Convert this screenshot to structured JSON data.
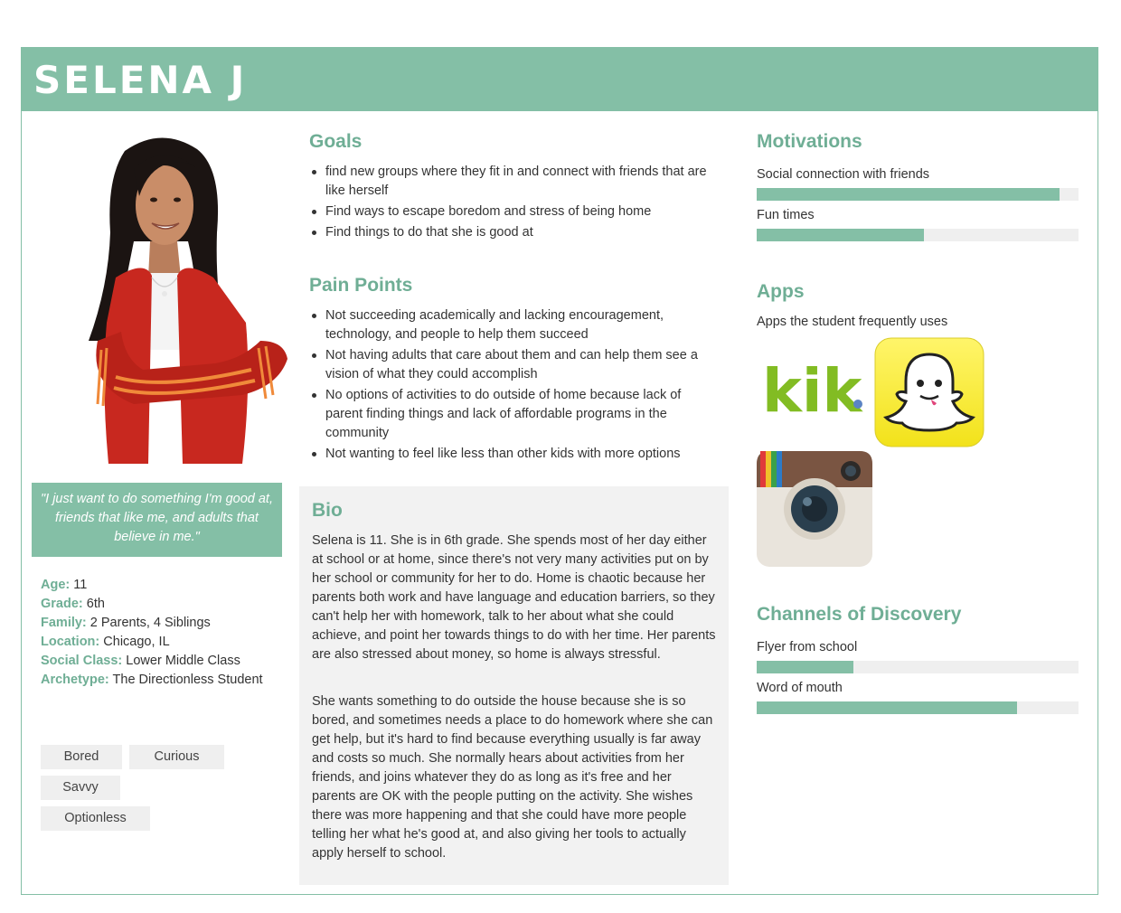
{
  "persona": {
    "name": "SELENA J",
    "quote": "\"I just want to do something I'm good at, friends that like me, and adults that believe in me.\"",
    "facts": [
      {
        "key": "Age:",
        "value": " 11"
      },
      {
        "key": "Grade:",
        "value": " 6th"
      },
      {
        "key": "Family:",
        "value": " 2 Parents, 4 Siblings"
      },
      {
        "key": "Location:",
        "value": " Chicago, IL"
      },
      {
        "key": "Social Class:",
        "value": " Lower Middle Class"
      },
      {
        "key": "Archetype:",
        "value": " The Directionless Student"
      }
    ],
    "tags": [
      "Bored",
      "Curious",
      "Savvy",
      "Optionless"
    ]
  },
  "goals": {
    "title": "Goals",
    "items": [
      "find new groups where they fit in and connect with friends that are like herself",
      "Find ways to escape boredom and stress of being home",
      "Find things to do that she is good at"
    ]
  },
  "pain_points": {
    "title": "Pain Points",
    "items": [
      "Not succeeding academically and lacking encouragement, technology, and people to help them succeed",
      "Not having adults that care about them and can help them see a vision of what they could accomplish",
      "No options of activities to do outside of home because lack of parent finding things and lack of affordable programs in the community",
      "Not wanting to feel like less than other kids with more options"
    ]
  },
  "bio": {
    "title": "Bio",
    "paragraphs": [
      "Selena is 11. She is in 6th grade. She spends most of her day either at school or at home, since there's not very many activities put on by her school or community for her to do. Home is chaotic because her parents both work and have language and education barriers, so they can't help her with homework, talk to her about what she could achieve, and point her towards things to do with her time. Her parents are also stressed about money, so home is always stressful.",
      "She wants something to do outside the house because she is so bored, and sometimes needs a place to do homework where she can get help, but it's hard to find because everything usually is far away and costs so much. She normally hears about activities from her friends, and joins whatever they do as long as it's free and her parents are OK with the people putting on the activity. She wishes there was more happening and that she could have more people telling her what he's good at, and also giving her tools to actually apply herself to school."
    ]
  },
  "motivations": {
    "title": "Motivations",
    "items": [
      {
        "label": "Social connection with friends",
        "level": 0.94
      },
      {
        "label": "Fun times",
        "level": 0.52
      }
    ]
  },
  "apps": {
    "title": "Apps",
    "subtitle": "Apps the student frequently uses",
    "icons": [
      {
        "name": "kik-icon",
        "wordmark": "kik"
      },
      {
        "name": "snapchat-icon"
      },
      {
        "name": "instagram-icon"
      }
    ]
  },
  "channels": {
    "title": "Channels of Discovery",
    "items": [
      {
        "label": "Flyer from school",
        "level": 0.3
      },
      {
        "label": "Word of mouth",
        "level": 0.81
      }
    ]
  },
  "colors": {
    "accent": "#84bfa6",
    "accent_text": "#6fae95",
    "track": "#efefef",
    "bio_bg": "#f2f2f2"
  }
}
